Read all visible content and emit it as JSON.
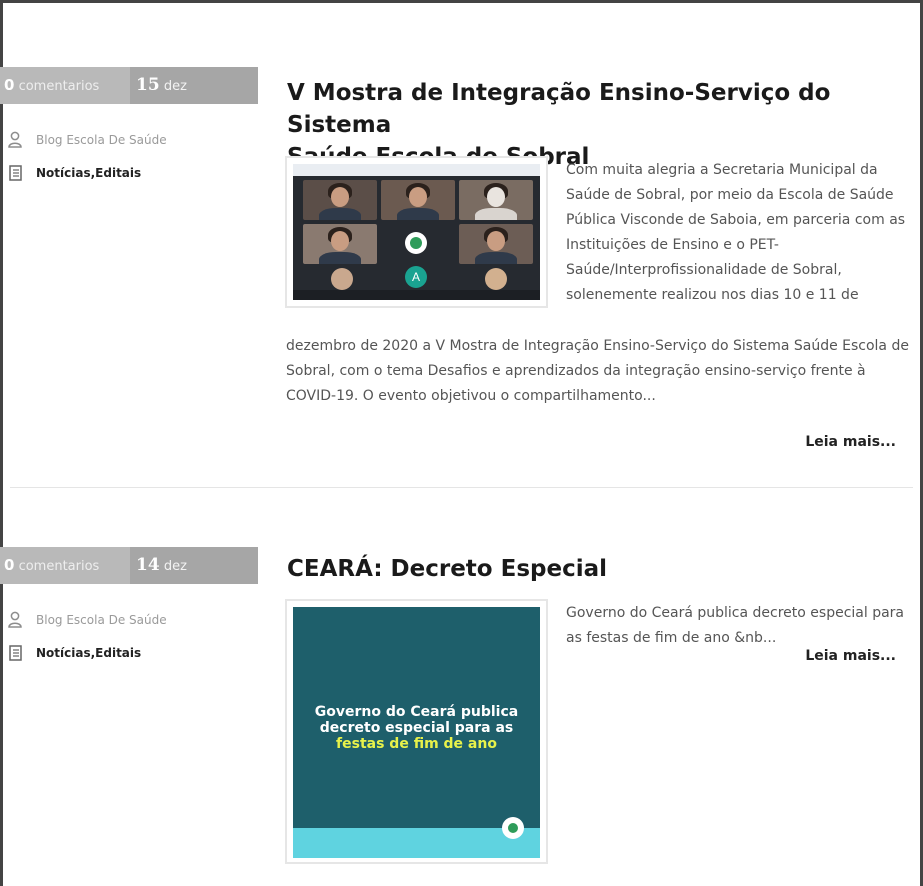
{
  "posts": [
    {
      "comments_count": "0",
      "comments_label": "comentarios",
      "day": "15",
      "month": "dez",
      "author": "Blog Escola De Saúde",
      "categories": [
        "Notícias",
        "Editais"
      ],
      "category_separator": ", ",
      "title_line1": "V Mostra de Integração Ensino-Serviço do Sistema",
      "title_line2": "Saúde Escola de Sobral",
      "excerpt_side": "Com muita alegria a Secretaria Municipal da Saúde de Sobral, por meio da Escola de Saúde Pública Visconde de Saboia, em parceria com as Instituições de Ensino e o PET-Saúde/Interprofissionalidade de Sobral, solenemente realizou nos dias 10 e 11 de",
      "excerpt_full": "dezembro de 2020 a V Mostra de Integração Ensino-Serviço do Sistema Saúde Escola de Sobral, com o tema Desafios e aprendizados da integração ensino-serviço frente à COVID-19. O evento objetivou o compartilhamento...",
      "read_more": "Leia mais...",
      "thumbnail": {
        "avatar_letter": "A"
      }
    },
    {
      "comments_count": "0",
      "comments_label": "comentarios",
      "day": "14",
      "month": "dez",
      "author": "Blog Escola De Saúde",
      "categories": [
        "Notícias",
        "Editais"
      ],
      "category_separator": ", ",
      "title": "CEARÁ: Decreto Especial",
      "excerpt": "Governo do Ceará publica decreto especial para as festas de fim de ano &nb...",
      "read_more": "Leia mais...",
      "thumbnail": {
        "line1": "Governo do Ceará publica",
        "line2": "decreto especial para as",
        "line3": "festas de fim de ano"
      }
    }
  ],
  "icons": {
    "author": "user-icon",
    "category": "document-icon"
  },
  "colors": {
    "meta_comments_bg": "#b9b9b9",
    "meta_date_bg": "#a6a6a6",
    "decree_bg": "#1e5f6b",
    "decree_highlight": "#e8f24a"
  }
}
